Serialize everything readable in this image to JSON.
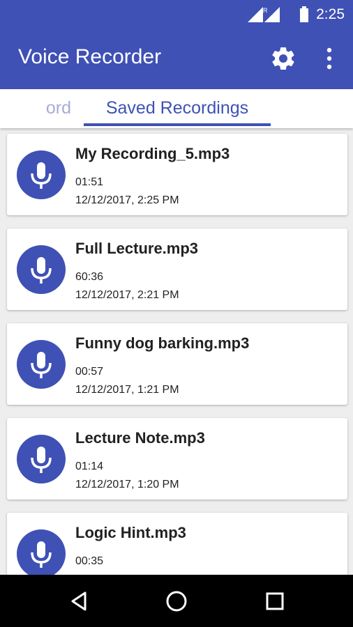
{
  "status_bar": {
    "time": "2:25",
    "roaming_indicator": "R",
    "icons": [
      "wifi-signal-icon",
      "cell-signal-icon",
      "battery-icon"
    ]
  },
  "app_bar": {
    "title": "Voice Recorder",
    "icons": [
      "settings-gear-icon",
      "more-vert-icon"
    ]
  },
  "tabs": [
    {
      "label": "Record",
      "visible_label": "ord",
      "selected": false
    },
    {
      "label": "Saved Recordings",
      "selected": true
    }
  ],
  "recordings": [
    {
      "name": "My Recording_5.mp3",
      "length": "01:51",
      "date": "12/12/2017, 2:25 PM"
    },
    {
      "name": "Full Lecture.mp3",
      "length": "60:36",
      "date": "12/12/2017, 2:21 PM"
    },
    {
      "name": "Funny dog barking.mp3",
      "length": "00:57",
      "date": "12/12/2017, 1:21 PM"
    },
    {
      "name": "Lecture Note.mp3",
      "length": "01:14",
      "date": "12/12/2017, 1:20 PM"
    },
    {
      "name": "Logic Hint.mp3",
      "length": "00:35",
      "date": ""
    }
  ],
  "nav_bar": {
    "icons": [
      "back-icon",
      "home-icon",
      "recents-icon"
    ]
  },
  "colors": {
    "primary": "#3f51b5",
    "tab_inactive": "#a6acd8",
    "card_background": "#ffffff",
    "list_background": "#eeeeee",
    "nav_bar": "#000000"
  }
}
